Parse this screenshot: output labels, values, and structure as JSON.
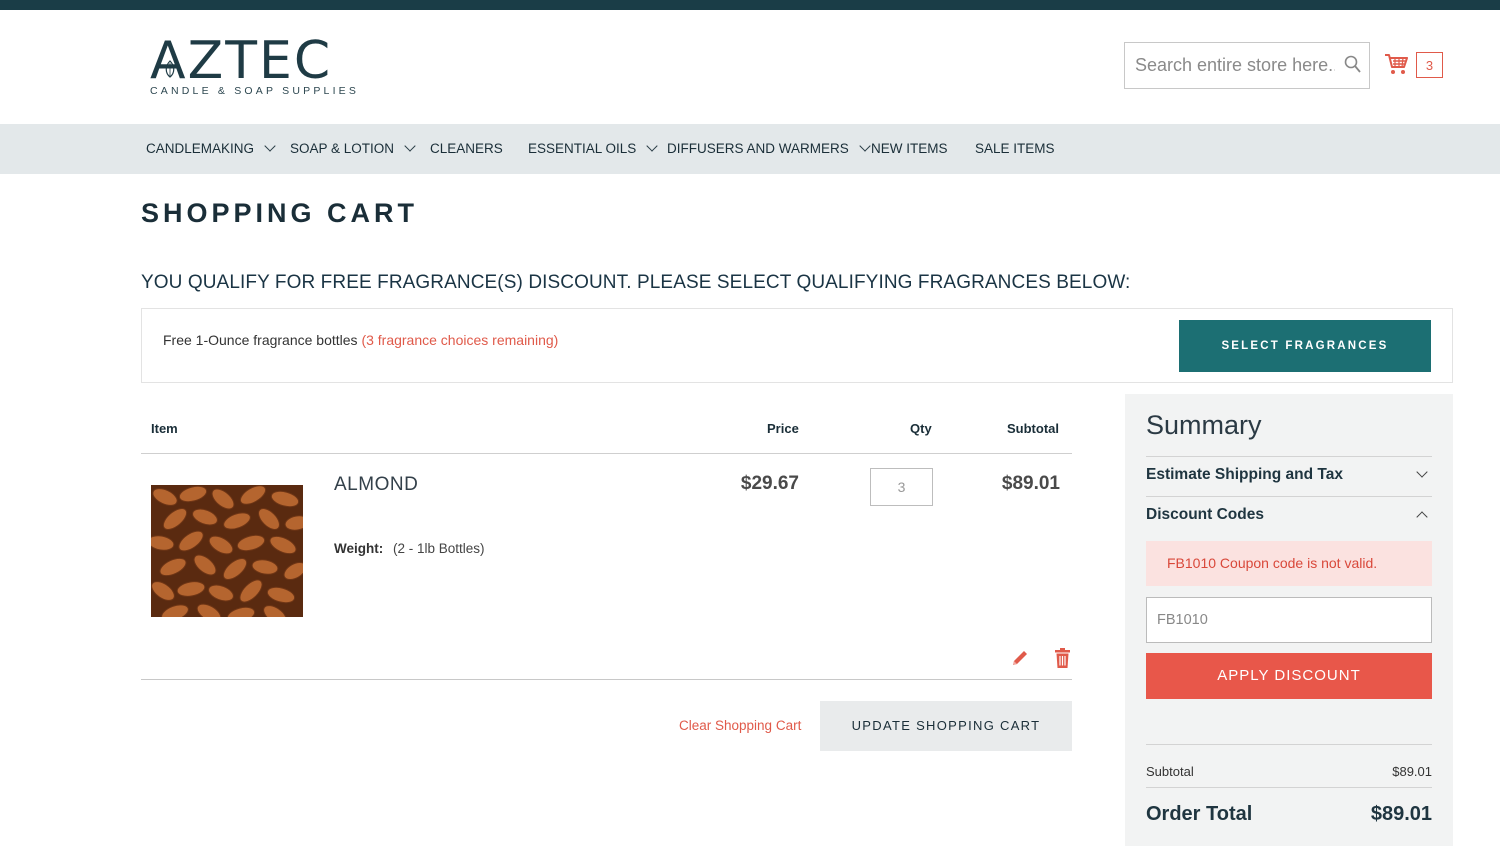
{
  "brand": {
    "name": "AZTEC",
    "tagline": "CANDLE & SOAP SUPPLIES",
    "primary_color": "#1a3d47",
    "accent_color": "#e05a4a",
    "teal_color": "#1c6f73"
  },
  "search": {
    "placeholder": "Search entire store here...",
    "icon": "search-icon"
  },
  "minicart": {
    "icon": "cart-icon",
    "count": "3"
  },
  "nav": {
    "items": [
      {
        "label": "CANDLEMAKING",
        "has_dropdown": true
      },
      {
        "label": "SOAP & LOTION",
        "has_dropdown": true
      },
      {
        "label": "CLEANERS",
        "has_dropdown": false
      },
      {
        "label": "ESSENTIAL OILS",
        "has_dropdown": true
      },
      {
        "label": "DIFFUSERS AND WARMERS",
        "has_dropdown": true
      },
      {
        "label": "NEW ITEMS",
        "has_dropdown": false
      },
      {
        "label": "SALE ITEMS",
        "has_dropdown": false
      }
    ]
  },
  "page": {
    "title": "SHOPPING CART"
  },
  "promo": {
    "heading": "YOU QUALIFY FOR FREE FRAGRANCE(S) DISCOUNT. PLEASE SELECT QUALIFYING FRAGRANCES BELOW:",
    "offer_text": "Free 1-Ounce fragrance bottles",
    "remaining_text": "(3 fragrance choices remaining)",
    "button_label": "SELECT FRAGRANCES"
  },
  "cart": {
    "columns": {
      "item": "Item",
      "price": "Price",
      "qty": "Qty",
      "subtotal": "Subtotal"
    },
    "items": [
      {
        "name": "ALMOND",
        "option_label": "Weight:",
        "option_value": "(2 - 1lb Bottles)",
        "price": "$29.67",
        "qty": "3",
        "subtotal": "$89.01"
      }
    ],
    "clear_label": "Clear Shopping Cart",
    "update_label": "UPDATE SHOPPING CART"
  },
  "summary": {
    "title": "Summary",
    "shipping_label": "Estimate Shipping and Tax",
    "discount_label": "Discount Codes",
    "error_message": "FB1010 Coupon code is not valid.",
    "discount_code_value": "FB1010",
    "apply_label": "APPLY DISCOUNT",
    "subtotal_label": "Subtotal",
    "subtotal_value": "$89.01",
    "order_total_label": "Order Total",
    "order_total_value": "$89.01"
  }
}
